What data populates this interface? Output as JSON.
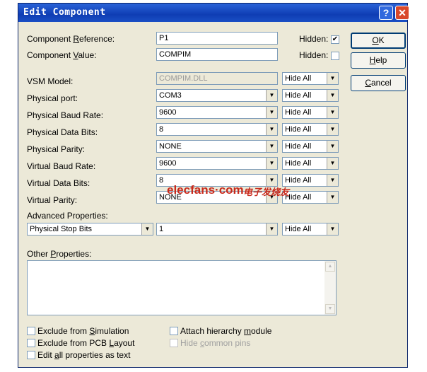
{
  "window": {
    "title": "Edit Component",
    "help_glyph": "?",
    "close_glyph": "✕"
  },
  "buttons": {
    "ok": "OK",
    "help": "Help",
    "cancel": "Cancel"
  },
  "component": {
    "reference_label": "Component Reference:",
    "reference_value": "P1",
    "reference_hidden_label": "Hidden:",
    "reference_hidden_checked": true,
    "value_label": "Component Value:",
    "value_value": "COMPIM",
    "value_hidden_label": "Hidden:",
    "value_hidden_checked": false
  },
  "properties": [
    {
      "label": "VSM Model:",
      "value": "COMPIM.DLL",
      "visibility": "Hide All"
    },
    {
      "label": "Physical port:",
      "value": "COM3",
      "visibility": "Hide All"
    },
    {
      "label": "Physical Baud Rate:",
      "value": "9600",
      "visibility": "Hide All"
    },
    {
      "label": "Physical Data Bits:",
      "value": "8",
      "visibility": "Hide All"
    },
    {
      "label": "Physical Parity:",
      "value": "NONE",
      "visibility": "Hide All"
    },
    {
      "label": "Virtual Baud Rate:",
      "value": "9600",
      "visibility": "Hide All"
    },
    {
      "label": "Virtual Data Bits:",
      "value": "8",
      "visibility": "Hide All"
    },
    {
      "label": "Virtual Parity:",
      "value": "NONE",
      "visibility": "Hide All"
    }
  ],
  "advanced": {
    "label": "Advanced Properties:",
    "property": "Physical Stop Bits",
    "value": "1",
    "visibility": "Hide All"
  },
  "other": {
    "label": "Other Properties:",
    "text": ""
  },
  "options": {
    "exclude_simulation": "Exclude from Simulation",
    "exclude_pcb": "Exclude from PCB Layout",
    "edit_all": "Edit all properties as text",
    "attach_hierarchy": "Attach hierarchy module",
    "hide_common_pins": "Hide common pins"
  },
  "watermark": {
    "brand": "elecfans·com",
    "cn": "电子发烧友"
  }
}
